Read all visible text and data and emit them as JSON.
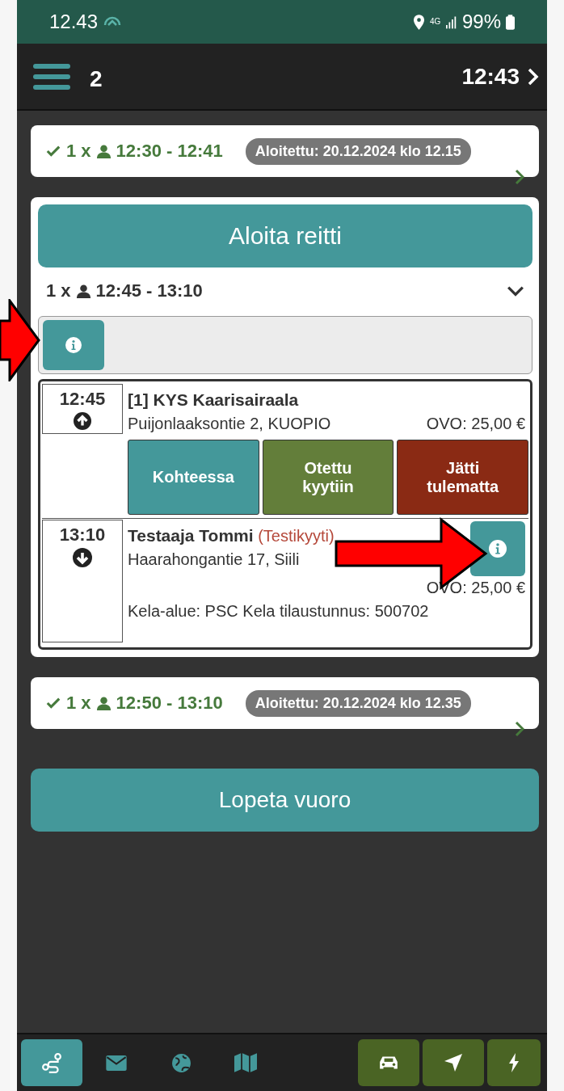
{
  "status_bar": {
    "time": "12.43",
    "network": "4G",
    "battery": "99%"
  },
  "header": {
    "count": "2",
    "time": "12:43"
  },
  "trips": [
    {
      "kind": "done",
      "passengers": "1 x",
      "time": "12:30 - 12:41",
      "started": "Aloitettu: 20.12.2024 klo 12.15"
    },
    {
      "kind": "active",
      "start_button": "Aloita reitti",
      "passengers": "1 x",
      "time": "12:45 - 13:10",
      "expanded": true,
      "stops": [
        {
          "time": "12:45",
          "kind": "pickup",
          "name": "[1] KYS Kaarisairaala",
          "address": "Puijonlaaksontie 2, KUOPIO",
          "price": "OVO: 25,00 €",
          "actions": [
            {
              "label": "Kohteessa",
              "kind": "arrived"
            },
            {
              "label": "Otettu kyytiin",
              "kind": "picked"
            },
            {
              "label": "Jätti tulematta",
              "kind": "noshow"
            }
          ]
        },
        {
          "time": "13:10",
          "kind": "dropoff",
          "name": "Testaaja Tommi",
          "note": "(Testikyyti)",
          "address": "Haarahongantie 17, Siili",
          "price": "OVO: 25,00 €",
          "extra": "Kela-alue: PSC Kela tilaustunnus: 500702",
          "info_button": true
        }
      ]
    },
    {
      "kind": "done",
      "passengers": "1 x",
      "time": "12:50 - 13:10",
      "started": "Aloitettu: 20.12.2024 klo 12.35"
    }
  ],
  "end_button": "Lopeta vuoro",
  "nav_tabs": [
    {
      "selected": true
    },
    {
      "selected": false
    },
    {
      "selected": false
    },
    {
      "selected": false
    }
  ]
}
